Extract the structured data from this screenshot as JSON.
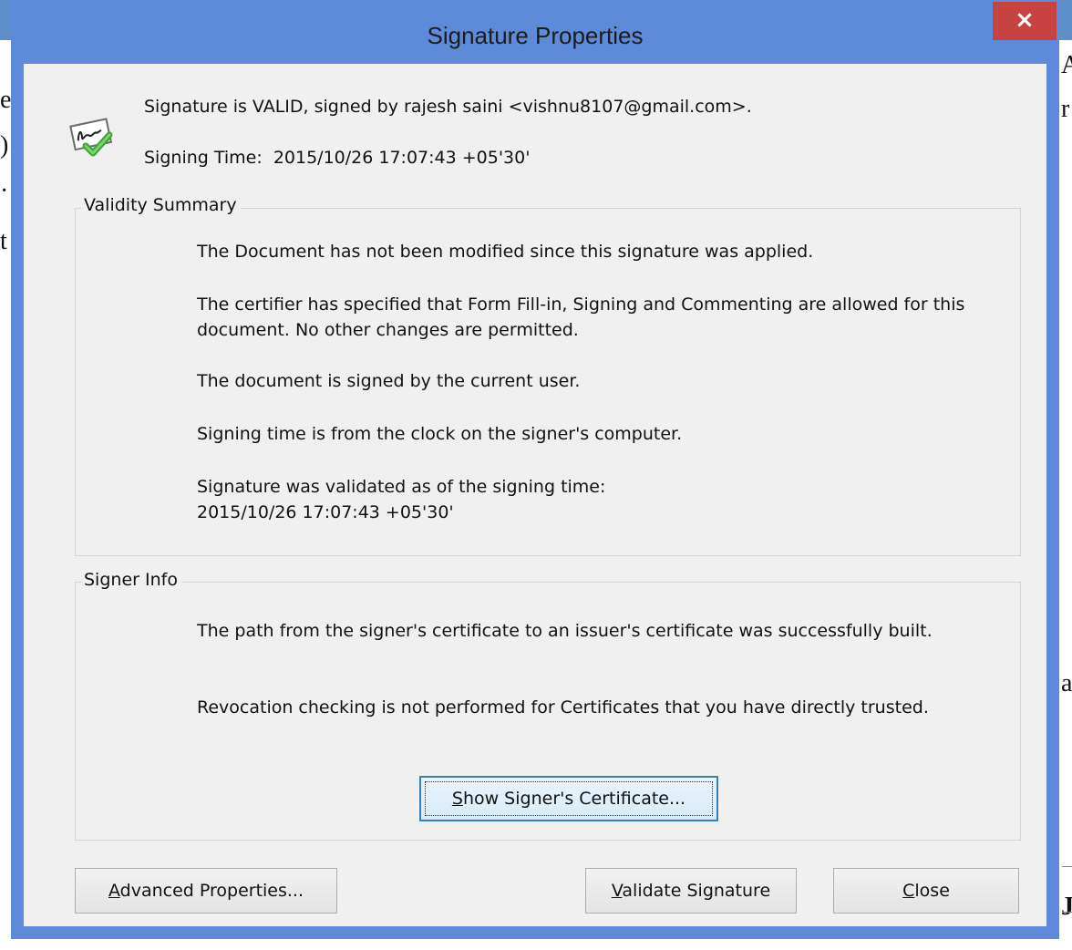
{
  "dialog": {
    "title": "Signature Properties",
    "close_glyph": "×"
  },
  "header": {
    "status_line": "Signature is VALID, signed by rajesh saini <vishnu8107@gmail.com>.",
    "signing_time_label": "Signing Time:",
    "signing_time_value": "2015/10/26 17:07:43 +05'30'",
    "icon": "signature-valid-icon"
  },
  "validity_summary": {
    "legend": "Validity Summary",
    "lines": [
      "The Document has not been modified since this signature was applied.",
      "The certifier has specified that Form Fill-in, Signing and Commenting are allowed for this document. No other changes are permitted.",
      "The document is signed by the current user.",
      "Signing time is from the clock on the signer's computer.",
      "Signature was validated as of the signing time:",
      "2015/10/26 17:07:43 +05'30'"
    ]
  },
  "signer_info": {
    "legend": "Signer Info",
    "lines": [
      "The path from the signer's certificate to an issuer's certificate was successfully built.",
      "Revocation checking is not performed for Certificates that you have directly trusted."
    ],
    "show_certificate_button": {
      "accel": "S",
      "rest": "how Signer's Certificate..."
    }
  },
  "buttons": {
    "advanced": {
      "accel": "A",
      "rest": "dvanced Properties..."
    },
    "validate": {
      "accel": "V",
      "rest": "alidate Signature"
    },
    "close": {
      "accel": "C",
      "rest": "lose"
    }
  },
  "background_fragments": {
    "left": [
      "e",
      ")",
      "·",
      "t"
    ],
    "right": [
      "A",
      "r",
      "a",
      "J"
    ]
  },
  "colors": {
    "title_bar": "#5d8bd9",
    "close_button": "#c74342",
    "client_background": "#f0f0f0"
  }
}
